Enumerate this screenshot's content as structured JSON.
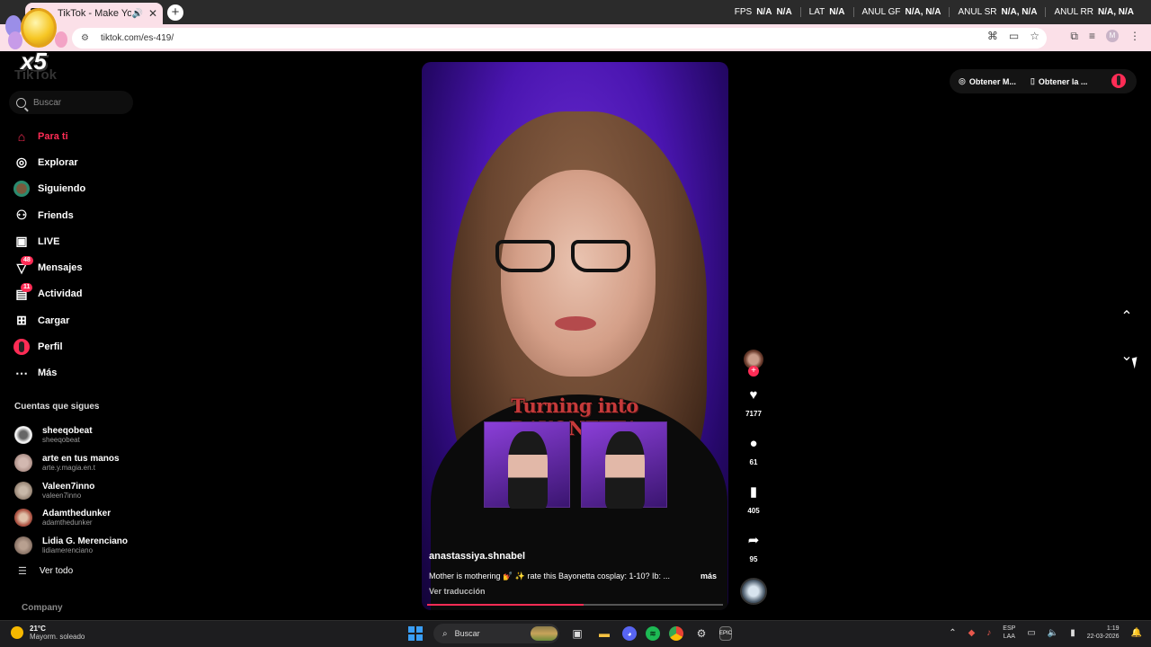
{
  "browser": {
    "tab_title": "TikTok - Make Your Day",
    "new_tab_symbol": "+",
    "url": "tiktok.com/es-419/",
    "profile_initial": "M"
  },
  "overlay": {
    "multiplier": "x5",
    "metrics": [
      {
        "label": "FPS",
        "values": [
          "N/A",
          "N/A"
        ]
      },
      {
        "label": "LAT",
        "values": [
          "N/A"
        ]
      },
      {
        "label": "ANUL GF",
        "values": [
          "N/A, N/A"
        ]
      },
      {
        "label": "ANUL SR",
        "values": [
          "N/A, N/A"
        ]
      },
      {
        "label": "ANUL RR",
        "values": [
          "N/A, N/A"
        ]
      }
    ]
  },
  "sidebar": {
    "logo": "TikTok",
    "search_placeholder": "Buscar",
    "items": [
      {
        "label": "Para ti",
        "icon": "home-icon",
        "active": true
      },
      {
        "label": "Explorar",
        "icon": "compass-icon"
      },
      {
        "label": "Siguiendo",
        "icon": "following-avatar-icon"
      },
      {
        "label": "Friends",
        "icon": "friends-icon"
      },
      {
        "label": "LIVE",
        "icon": "live-tv-icon"
      },
      {
        "label": "Mensajes",
        "icon": "send-icon",
        "badge": "48"
      },
      {
        "label": "Actividad",
        "icon": "activity-icon",
        "badge": "11"
      },
      {
        "label": "Cargar",
        "icon": "upload-plus-icon"
      },
      {
        "label": "Perfil",
        "icon": "profile-avatar-icon"
      },
      {
        "label": "Más",
        "icon": "more-dots-icon"
      }
    ],
    "following_title": "Cuentas que sigues",
    "following": [
      {
        "name": "sheeqobeat",
        "handle": "sheeqobeat"
      },
      {
        "name": "arte en tus manos",
        "handle": "arte.y.magia.en.t"
      },
      {
        "name": "Valeen7inno",
        "handle": "valeen7inno"
      },
      {
        "name": "Adamthedunker",
        "handle": "adamthedunker"
      },
      {
        "name": "Lidia G. Merenciano",
        "handle": "lidiamerenciano"
      }
    ],
    "see_all": "Ver todo",
    "company": "Company"
  },
  "video": {
    "overlay_title": "Turning into BAYONETTA",
    "author": "anastassiya.shnabel",
    "caption": "Mother is mothering 💅 ✨ rate this Bayonetta cosplay: 1-10? Ib: ...",
    "more": "más",
    "translate": "Ver traducción",
    "progress": 0.53
  },
  "actions": {
    "likes": "7177",
    "comments": "61",
    "saves": "405",
    "shares": "95"
  },
  "top_right": {
    "get_coins": "Obtener M...",
    "get_app": "Obtener la ..."
  },
  "taskbar": {
    "temperature": "21°C",
    "condition": "Mayorm. soleado",
    "search_placeholder": "Buscar",
    "lang_line1": "ESP",
    "lang_line2": "LAA",
    "time": "1:19",
    "date": "22-03-2026"
  },
  "colors": {
    "accent": "#fe2c55",
    "tab_bg": "#fbe0e8",
    "video_purple": "#5a1fc4"
  }
}
